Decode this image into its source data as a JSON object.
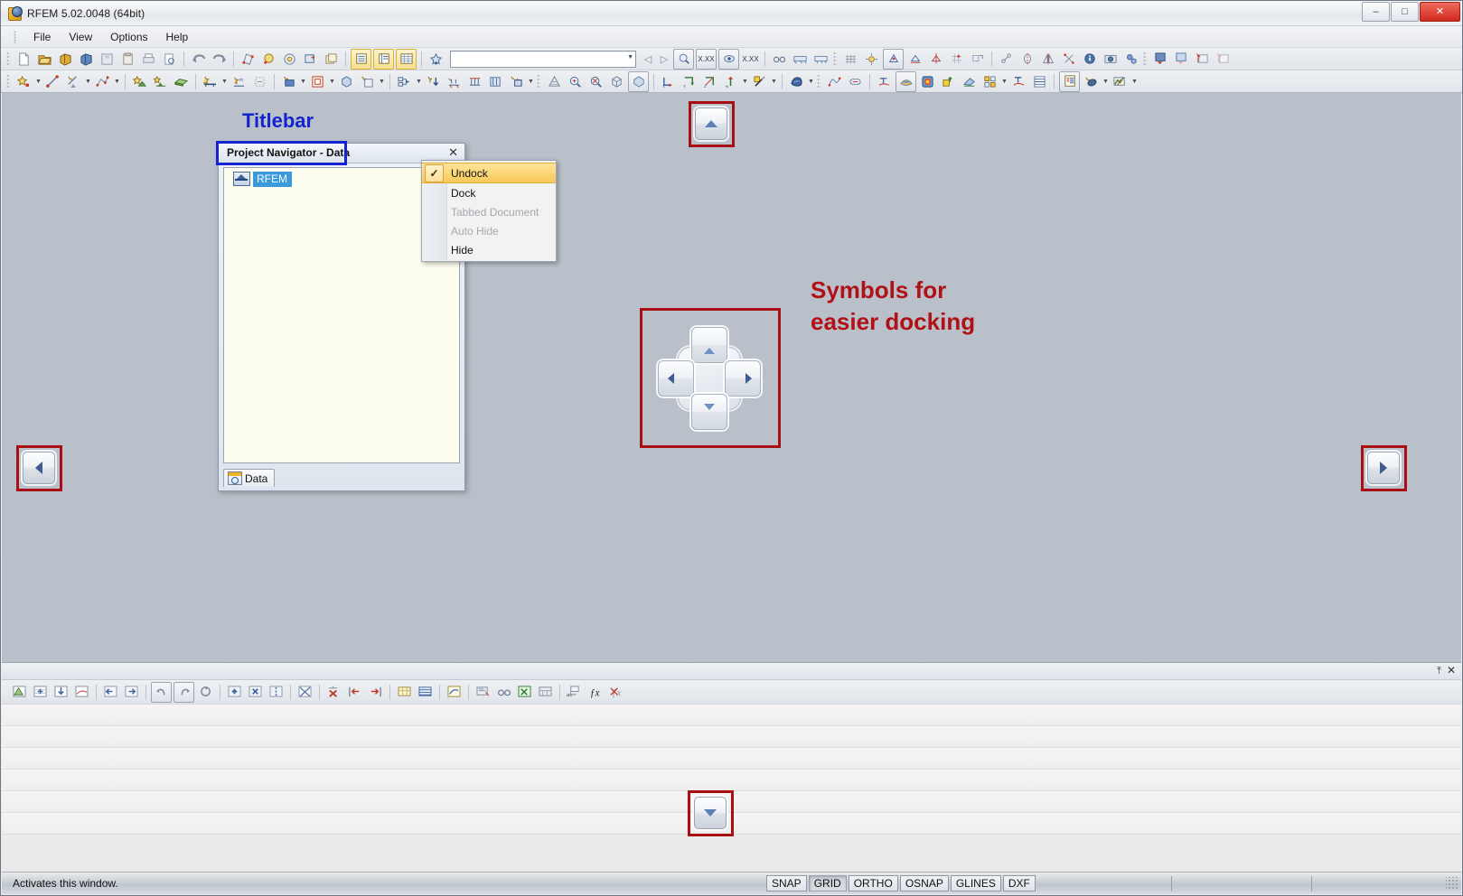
{
  "window": {
    "title": "RFEM 5.02.0048 (64bit)",
    "app_icon": "rfem-app-icon",
    "minimize_label": "–",
    "maximize_label": "□",
    "close_label": "✕"
  },
  "menubar": {
    "items": [
      {
        "label": "File",
        "mnemonic": "F"
      },
      {
        "label": "View",
        "mnemonic": "V"
      },
      {
        "label": "Options",
        "mnemonic": "p"
      },
      {
        "label": "Help",
        "mnemonic": "H"
      }
    ]
  },
  "toolbar_top": {
    "combo_value": "",
    "combo_placeholder": "",
    "xx_label_1": "X.XX",
    "xx_label_2": "X.XX",
    "prev_label": "◁",
    "next_label": "▷"
  },
  "annotations": {
    "titlebar": "Titlebar",
    "symbols_line1": "Symbols for",
    "symbols_line2": "easier docking",
    "titlebar_color": "#1524cf",
    "symbols_color": "#b01116",
    "highlight_box_color": "#a80f12"
  },
  "panel": {
    "title": "Project Navigator - Data",
    "close_label": "✕",
    "tree": [
      {
        "label": "RFEM",
        "icon": "rfem-model-icon",
        "selected": true
      }
    ],
    "tabs": [
      {
        "label": "Data",
        "icon": "data-tab-icon",
        "active": true
      }
    ]
  },
  "context_menu": {
    "items": [
      {
        "label": "Undock",
        "checked": true,
        "enabled": true,
        "highlighted": true
      },
      {
        "label": "Dock",
        "checked": false,
        "enabled": true,
        "highlighted": false
      },
      {
        "label": "Tabbed Document",
        "checked": false,
        "enabled": false,
        "highlighted": false
      },
      {
        "label": "Auto Hide",
        "checked": false,
        "enabled": false,
        "highlighted": false
      },
      {
        "label": "Hide",
        "checked": false,
        "enabled": true,
        "highlighted": false
      }
    ],
    "check_glyph": "✓"
  },
  "dock_guides": {
    "top": {
      "name": "dock-guide-top",
      "direction": "up"
    },
    "left": {
      "name": "dock-guide-left",
      "direction": "left"
    },
    "right": {
      "name": "dock-guide-right",
      "direction": "right"
    },
    "bottom": {
      "name": "dock-guide-bottom",
      "direction": "down"
    },
    "center": {
      "name": "dock-guide-center",
      "buttons": [
        "up",
        "left",
        "right",
        "down"
      ]
    }
  },
  "bottom_pane": {
    "pin_label": "⤒",
    "close_label": "✕",
    "fx_label": "ƒx",
    "fx_strike_label": "ƒx",
    "ab_label": "ab="
  },
  "statusbar": {
    "message": "Activates this window.",
    "cells": [
      {
        "label": "SNAP",
        "pressed": false
      },
      {
        "label": "GRID",
        "pressed": true
      },
      {
        "label": "ORTHO",
        "pressed": false
      },
      {
        "label": "OSNAP",
        "pressed": false
      },
      {
        "label": "GLINES",
        "pressed": false
      },
      {
        "label": "DXF",
        "pressed": false
      }
    ]
  }
}
